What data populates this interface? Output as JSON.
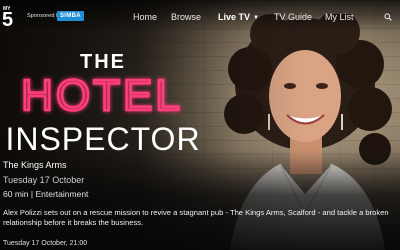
{
  "channel": {
    "logo_text": "5",
    "logo_top": "MY",
    "sponsor_text": "Sponsored by",
    "sponsor_brand": "SIMBA"
  },
  "nav": {
    "items": [
      {
        "label": "Home",
        "active": false
      },
      {
        "label": "Browse",
        "active": false
      },
      {
        "label": "Live TV",
        "active": true,
        "caret": "▼"
      },
      {
        "label": "TV Guide",
        "active": false
      },
      {
        "label": "My List",
        "active": false
      }
    ],
    "search_icon": "search-icon"
  },
  "show": {
    "title_line1": "THE",
    "title_line2": "HOTEL",
    "title_line3": "INSPECTOR"
  },
  "episode": {
    "title": "The Kings Arms",
    "date": "Tuesday 17 October",
    "duration": "60 min",
    "separator": "|",
    "genre": "Entertainment",
    "description": "Alex Polizzi sets out on a rescue mission to revive a stagnant pub - The Kings Arms, Scalford - and tackle a broken relationship before it breaks the business.",
    "airing": "Tuesday 17 October, 21:00"
  },
  "colors": {
    "accent": "#d4145a",
    "neon": "#ff3d7a",
    "brand": "#1f8fd6"
  }
}
